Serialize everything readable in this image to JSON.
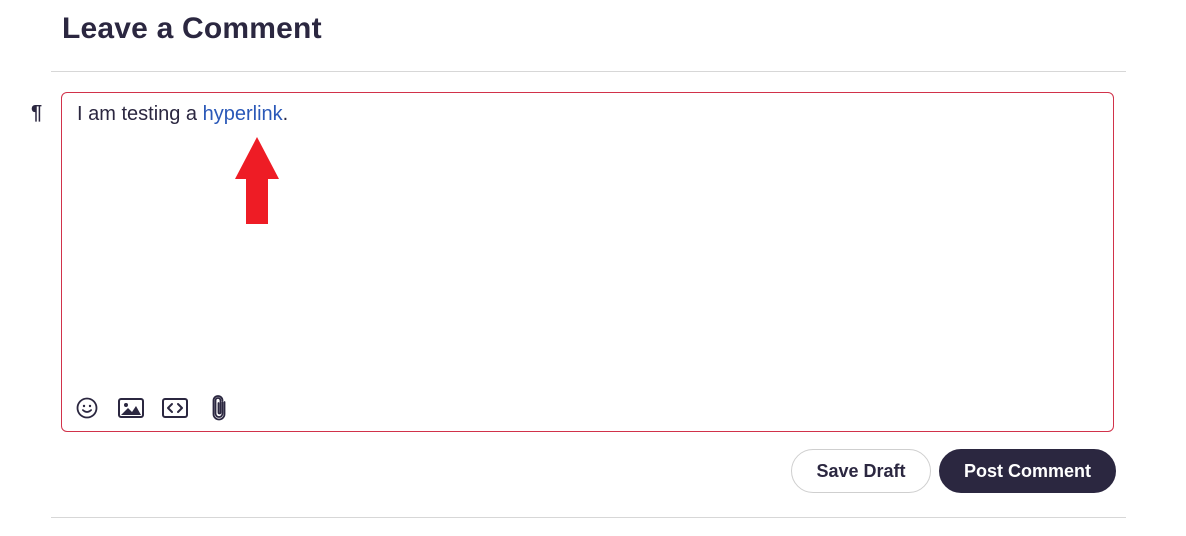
{
  "heading": "Leave a Comment",
  "editor": {
    "paragraph_marker": "¶",
    "text_before": "I am testing a ",
    "link_text": "hyperlink",
    "text_after": "."
  },
  "toolbar": {
    "icons": [
      "emoji-icon",
      "image-icon",
      "code-icon",
      "attachment-icon"
    ]
  },
  "actions": {
    "save_draft_label": "Save Draft",
    "post_comment_label": "Post Comment"
  },
  "colors": {
    "editor_border": "#d1324a",
    "link": "#2a58b8",
    "primary_button": "#2b2740",
    "annotation_arrow": "#ee1c25"
  }
}
